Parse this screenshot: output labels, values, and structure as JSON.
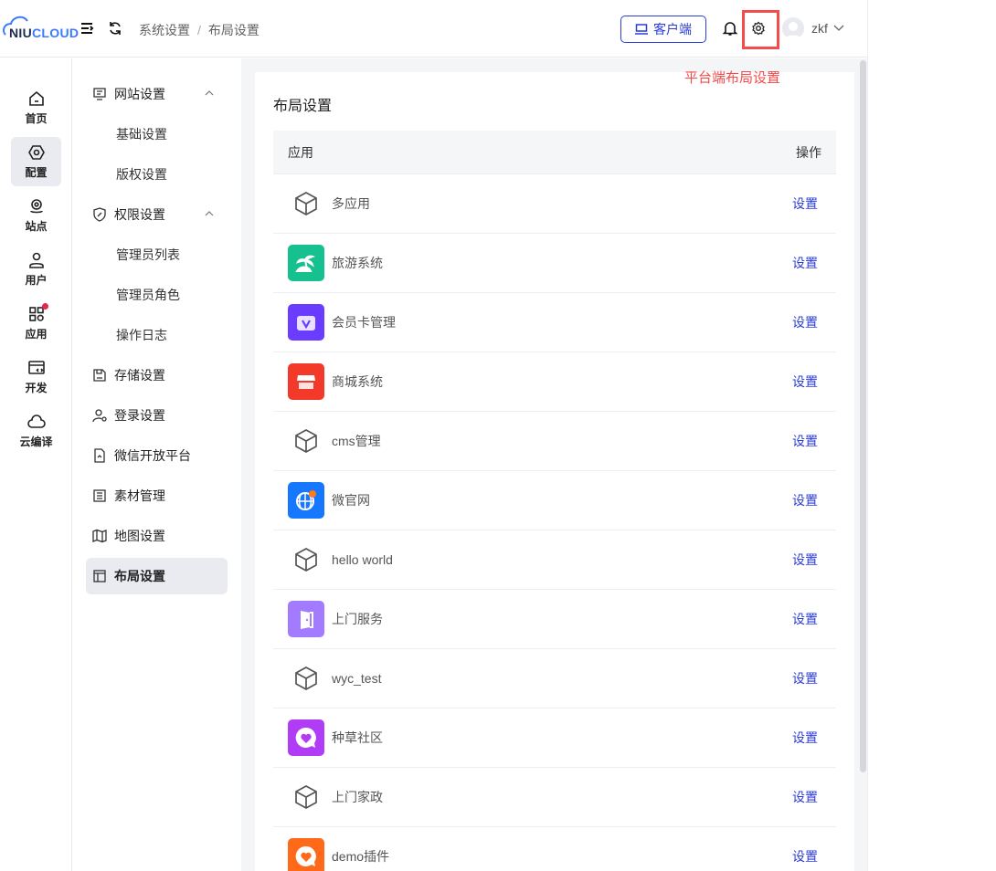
{
  "header": {
    "logo": "NIUCLOUD",
    "breadcrumb": [
      "系统设置",
      "布局设置"
    ],
    "client_button": "客户端",
    "username": "zkf",
    "annotation": "平台端布局设置"
  },
  "rail": [
    {
      "label": "首页",
      "icon": "home-icon"
    },
    {
      "label": "配置",
      "icon": "settings-hex-icon",
      "active": true
    },
    {
      "label": "站点",
      "icon": "location-icon"
    },
    {
      "label": "用户",
      "icon": "user-icon"
    },
    {
      "label": "应用",
      "icon": "apps-icon",
      "badge": true
    },
    {
      "label": "开发",
      "icon": "code-window-icon"
    },
    {
      "label": "云编译",
      "icon": "cloud-icon"
    }
  ],
  "submenu": [
    {
      "label": "网站设置",
      "icon": "monitor-icon",
      "group": true,
      "expanded": true
    },
    {
      "label": "基础设置",
      "child": true
    },
    {
      "label": "版权设置",
      "child": true
    },
    {
      "label": "权限设置",
      "icon": "shield-icon",
      "group": true,
      "expanded": true
    },
    {
      "label": "管理员列表",
      "child": true
    },
    {
      "label": "管理员角色",
      "child": true
    },
    {
      "label": "操作日志",
      "child": true
    },
    {
      "label": "存储设置",
      "icon": "save-icon"
    },
    {
      "label": "登录设置",
      "icon": "user-gear-icon"
    },
    {
      "label": "微信开放平台",
      "icon": "file-icon"
    },
    {
      "label": "素材管理",
      "icon": "list-icon"
    },
    {
      "label": "地图设置",
      "icon": "map-icon"
    },
    {
      "label": "布局设置",
      "icon": "layout-icon",
      "active": true
    }
  ],
  "main": {
    "title": "布局设置",
    "columns": {
      "app": "应用",
      "action": "操作"
    },
    "rows": [
      {
        "name": "多应用",
        "icon": "box",
        "action": "设置"
      },
      {
        "name": "旅游系统",
        "icon": "palm",
        "color": "#16c08f",
        "action": "设置"
      },
      {
        "name": "会员卡管理",
        "icon": "vcard",
        "color": "#6a3cff",
        "action": "设置"
      },
      {
        "name": "商城系统",
        "icon": "shop",
        "color": "#f33a2a",
        "action": "设置"
      },
      {
        "name": "cms管理",
        "icon": "box",
        "action": "设置"
      },
      {
        "name": "微官网",
        "icon": "globe",
        "color": "#1677ff",
        "action": "设置"
      },
      {
        "name": "hello world",
        "icon": "box",
        "action": "设置"
      },
      {
        "name": "上门服务",
        "icon": "door",
        "color": "#a27bff",
        "action": "设置"
      },
      {
        "name": "wyc_test",
        "icon": "box",
        "action": "设置"
      },
      {
        "name": "种草社区",
        "icon": "heart",
        "color": "#b13cf5",
        "action": "设置"
      },
      {
        "name": "上门家政",
        "icon": "box",
        "action": "设置"
      },
      {
        "name": "demo插件",
        "icon": "heart",
        "color": "#ff6a1a",
        "action": "设置"
      }
    ]
  }
}
